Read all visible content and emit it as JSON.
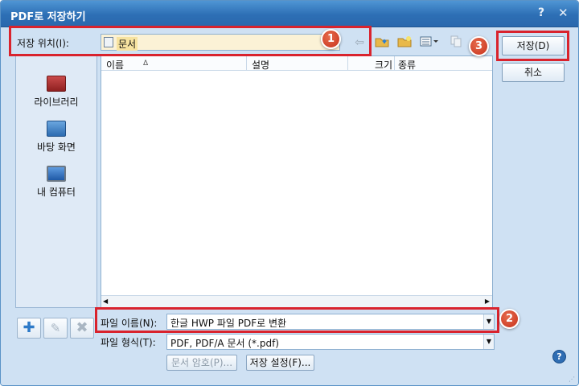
{
  "window": {
    "title": "PDF로 저장하기",
    "help_glyph": "?",
    "close_glyph": "✕"
  },
  "location": {
    "label": "저장 위치(I):",
    "value": "문서"
  },
  "places": [
    {
      "label": "라이브러리"
    },
    {
      "label": "바탕 화면"
    },
    {
      "label": "내 컴퓨터"
    }
  ],
  "filelist": {
    "columns": [
      "이름",
      "설명",
      "크기",
      "종류"
    ],
    "sort_indicator": "ᐃ"
  },
  "filename": {
    "label": "파일 이름(N):",
    "value": "한글 HWP 파일 PDF로 변환"
  },
  "filetype": {
    "label": "파일 형식(T):",
    "value": "PDF, PDF/A 문서 (*.pdf)"
  },
  "buttons": {
    "save": "저장(D)",
    "cancel": "취소",
    "password": "문서 암호(P)...",
    "settings": "저장 설정(F)..."
  },
  "badges": [
    "1",
    "2",
    "3"
  ],
  "colors": {
    "highlight": "#d9232d",
    "badge": "#d8452b",
    "titlebar": "#3b7fc4"
  },
  "icons": {
    "back": "back-arrow-icon",
    "up": "up-folder-icon",
    "new_folder": "new-folder-icon",
    "view": "view-menu-icon",
    "copy": "copy-icon"
  }
}
